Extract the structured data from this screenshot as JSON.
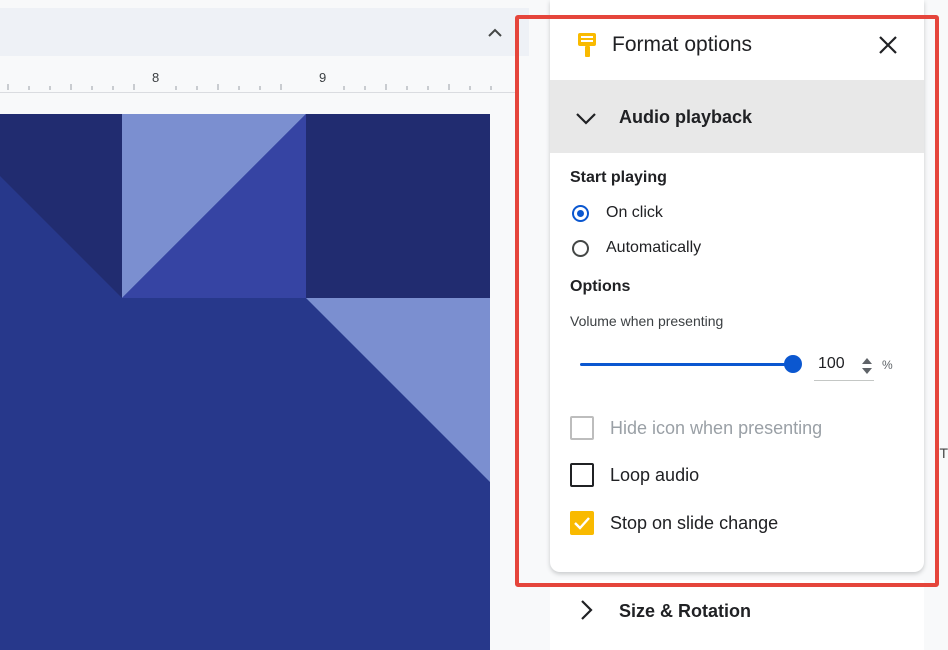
{
  "ruler": {
    "marks": [
      "8",
      "9"
    ]
  },
  "colors": {
    "accent": "#0b57d0",
    "checkbox_checked": "#f9ba00",
    "highlight": "#e5453b",
    "slide_bg": "#27388b"
  },
  "panel": {
    "icon": "paint-roller-icon",
    "title": "Format options",
    "close_icon": "close-icon"
  },
  "audio_section": {
    "title": "Audio playback",
    "expanded": true,
    "start_playing_label": "Start playing",
    "radio_options": [
      {
        "label": "On click",
        "selected": true
      },
      {
        "label": "Automatically",
        "selected": false
      }
    ],
    "options_label": "Options",
    "volume_label": "Volume when presenting",
    "volume_value": "100",
    "volume_unit": "%",
    "volume_fraction": 1.0,
    "checkboxes": [
      {
        "label": "Hide icon when presenting",
        "checked": false,
        "disabled": true
      },
      {
        "label": "Loop audio",
        "checked": false,
        "disabled": false
      },
      {
        "label": "Stop on slide change",
        "checked": true,
        "disabled": false
      }
    ]
  },
  "size_section": {
    "title": "Size & Rotation",
    "expanded": false
  },
  "edge_text": "T"
}
